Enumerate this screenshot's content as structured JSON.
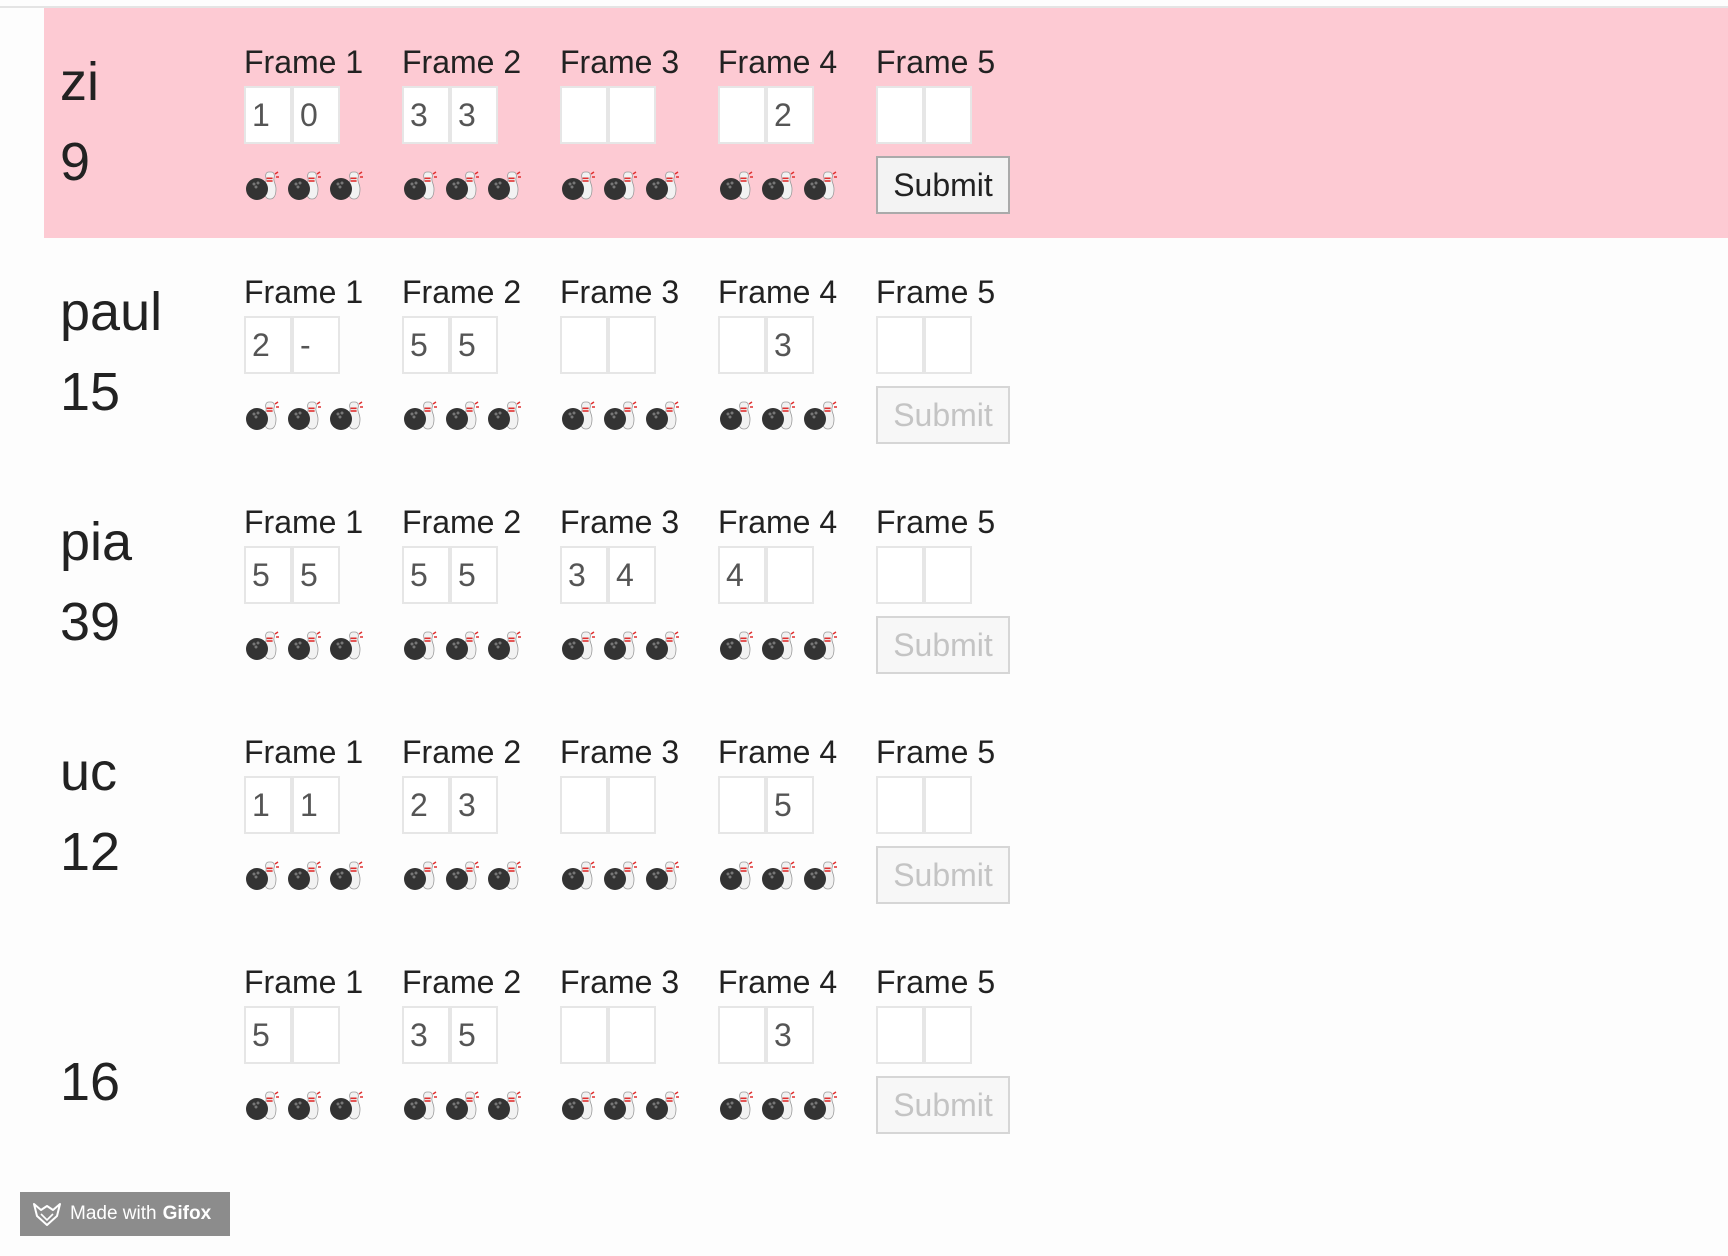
{
  "players": [
    {
      "name": "zi",
      "score": "9",
      "active": true,
      "frames": [
        {
          "label": "Frame 1",
          "rolls": [
            "1",
            "0"
          ]
        },
        {
          "label": "Frame 2",
          "rolls": [
            "3",
            "3"
          ]
        },
        {
          "label": "Frame 3",
          "rolls": [
            "",
            ""
          ]
        },
        {
          "label": "Frame 4",
          "rolls": [
            "",
            "2"
          ]
        },
        {
          "label": "Frame 5",
          "rolls": [
            "",
            ""
          ]
        }
      ],
      "submit_label": "Submit",
      "submit_enabled": true
    },
    {
      "name": "paul",
      "score": "15",
      "active": false,
      "frames": [
        {
          "label": "Frame 1",
          "rolls": [
            "2",
            "-"
          ]
        },
        {
          "label": "Frame 2",
          "rolls": [
            "5",
            "5"
          ]
        },
        {
          "label": "Frame 3",
          "rolls": [
            "",
            ""
          ]
        },
        {
          "label": "Frame 4",
          "rolls": [
            "",
            "3"
          ]
        },
        {
          "label": "Frame 5",
          "rolls": [
            "",
            ""
          ]
        }
      ],
      "submit_label": "Submit",
      "submit_enabled": false
    },
    {
      "name": "pia",
      "score": "39",
      "active": false,
      "frames": [
        {
          "label": "Frame 1",
          "rolls": [
            "5",
            "5"
          ]
        },
        {
          "label": "Frame 2",
          "rolls": [
            "5",
            "5"
          ]
        },
        {
          "label": "Frame 3",
          "rolls": [
            "3",
            "4"
          ]
        },
        {
          "label": "Frame 4",
          "rolls": [
            "4",
            ""
          ]
        },
        {
          "label": "Frame 5",
          "rolls": [
            "",
            ""
          ]
        }
      ],
      "submit_label": "Submit",
      "submit_enabled": false
    },
    {
      "name": "uc",
      "score": "12",
      "active": false,
      "frames": [
        {
          "label": "Frame 1",
          "rolls": [
            "1",
            "1"
          ]
        },
        {
          "label": "Frame 2",
          "rolls": [
            "2",
            "3"
          ]
        },
        {
          "label": "Frame 3",
          "rolls": [
            "",
            ""
          ]
        },
        {
          "label": "Frame 4",
          "rolls": [
            "",
            "5"
          ]
        },
        {
          "label": "Frame 5",
          "rolls": [
            "",
            ""
          ]
        }
      ],
      "submit_label": "Submit",
      "submit_enabled": false
    },
    {
      "name": "",
      "score": "16",
      "active": false,
      "frames": [
        {
          "label": "Frame 1",
          "rolls": [
            "5",
            ""
          ]
        },
        {
          "label": "Frame 2",
          "rolls": [
            "3",
            "5"
          ]
        },
        {
          "label": "Frame 3",
          "rolls": [
            "",
            ""
          ]
        },
        {
          "label": "Frame 4",
          "rolls": [
            "",
            "3"
          ]
        },
        {
          "label": "Frame 5",
          "rolls": [
            "",
            ""
          ]
        }
      ],
      "submit_label": "Submit",
      "submit_enabled": false
    }
  ],
  "pin_icon": "bowling-icon",
  "colors": {
    "active_row": "#fdcad3",
    "pin_red": "#e03030",
    "ball": "#333333"
  },
  "badge": {
    "prefix": "Made with",
    "brand": "Gifox",
    "icon": "fox-icon"
  }
}
